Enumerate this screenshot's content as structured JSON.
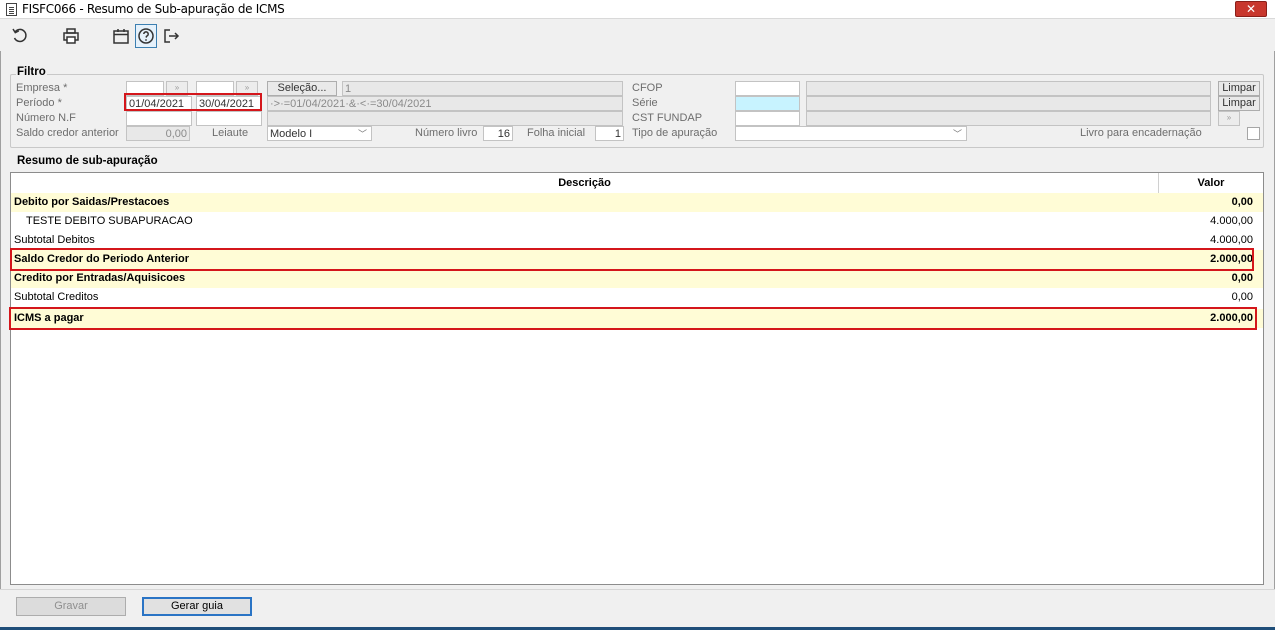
{
  "window": {
    "title": "FISFC066 - Resumo de Sub-apuração de ICMS",
    "close": "✕"
  },
  "toolbar": {
    "icons": [
      "refresh-icon",
      "print-icon",
      "calendar-icon",
      "help-icon",
      "exit-icon"
    ]
  },
  "filter": {
    "legend": "Filtro",
    "empresa_label": "Empresa *",
    "periodo_label": "Período *",
    "numero_nf_label": "Número N.F",
    "saldo_label": "Saldo credor anterior",
    "saldo_value": "0,00",
    "leiaute_label": "Leiaute",
    "leiaute_value": "Modelo I",
    "numero_livro_label": "Número livro",
    "numero_livro_value": "16",
    "folha_label": "Folha inicial",
    "folha_value": "1",
    "periodo_start": "01/04/2021",
    "periodo_end": "30/04/2021",
    "selecao_label": "Seleção...",
    "selecao_value": "1",
    "periodo_expr": "·>·=01/04/2021·&·<·=30/04/2021",
    "cfop_label": "CFOP",
    "serie_label": "Série",
    "cst_label": "CST FUNDAP",
    "tipo_label": "Tipo de apuração",
    "livro_label": "Livro para encadernação",
    "limpar1": "Limpar",
    "limpar2": "Limpar",
    "lookup_glyph": "»"
  },
  "resumo": {
    "label": "Resumo de sub-apuração",
    "col_desc": "Descrição",
    "col_valor": "Valor",
    "rows": [
      {
        "desc": "Debito por Saidas/Prestacoes",
        "valor": "0,00"
      },
      {
        "desc": "TESTE DEBITO SUBAPURACAO",
        "valor": "4.000,00"
      },
      {
        "desc": "Subtotal Debitos",
        "valor": "4.000,00"
      },
      {
        "desc": "Saldo Credor do Periodo Anterior",
        "valor": "2.000,00"
      },
      {
        "desc": "Credito por Entradas/Aquisicoes",
        "valor": "0,00"
      },
      {
        "desc": "Subtotal Creditos",
        "valor": "0,00"
      },
      {
        "desc": "ICMS a pagar",
        "valor": "2.000,00"
      }
    ]
  },
  "buttons": {
    "gravar": "Gravar",
    "gerar_guia": "Gerar guia"
  },
  "colors": {
    "highlight_row": "#fffcd6",
    "annotation_red": "#d4161b",
    "focus_blue": "#2a74c5"
  }
}
